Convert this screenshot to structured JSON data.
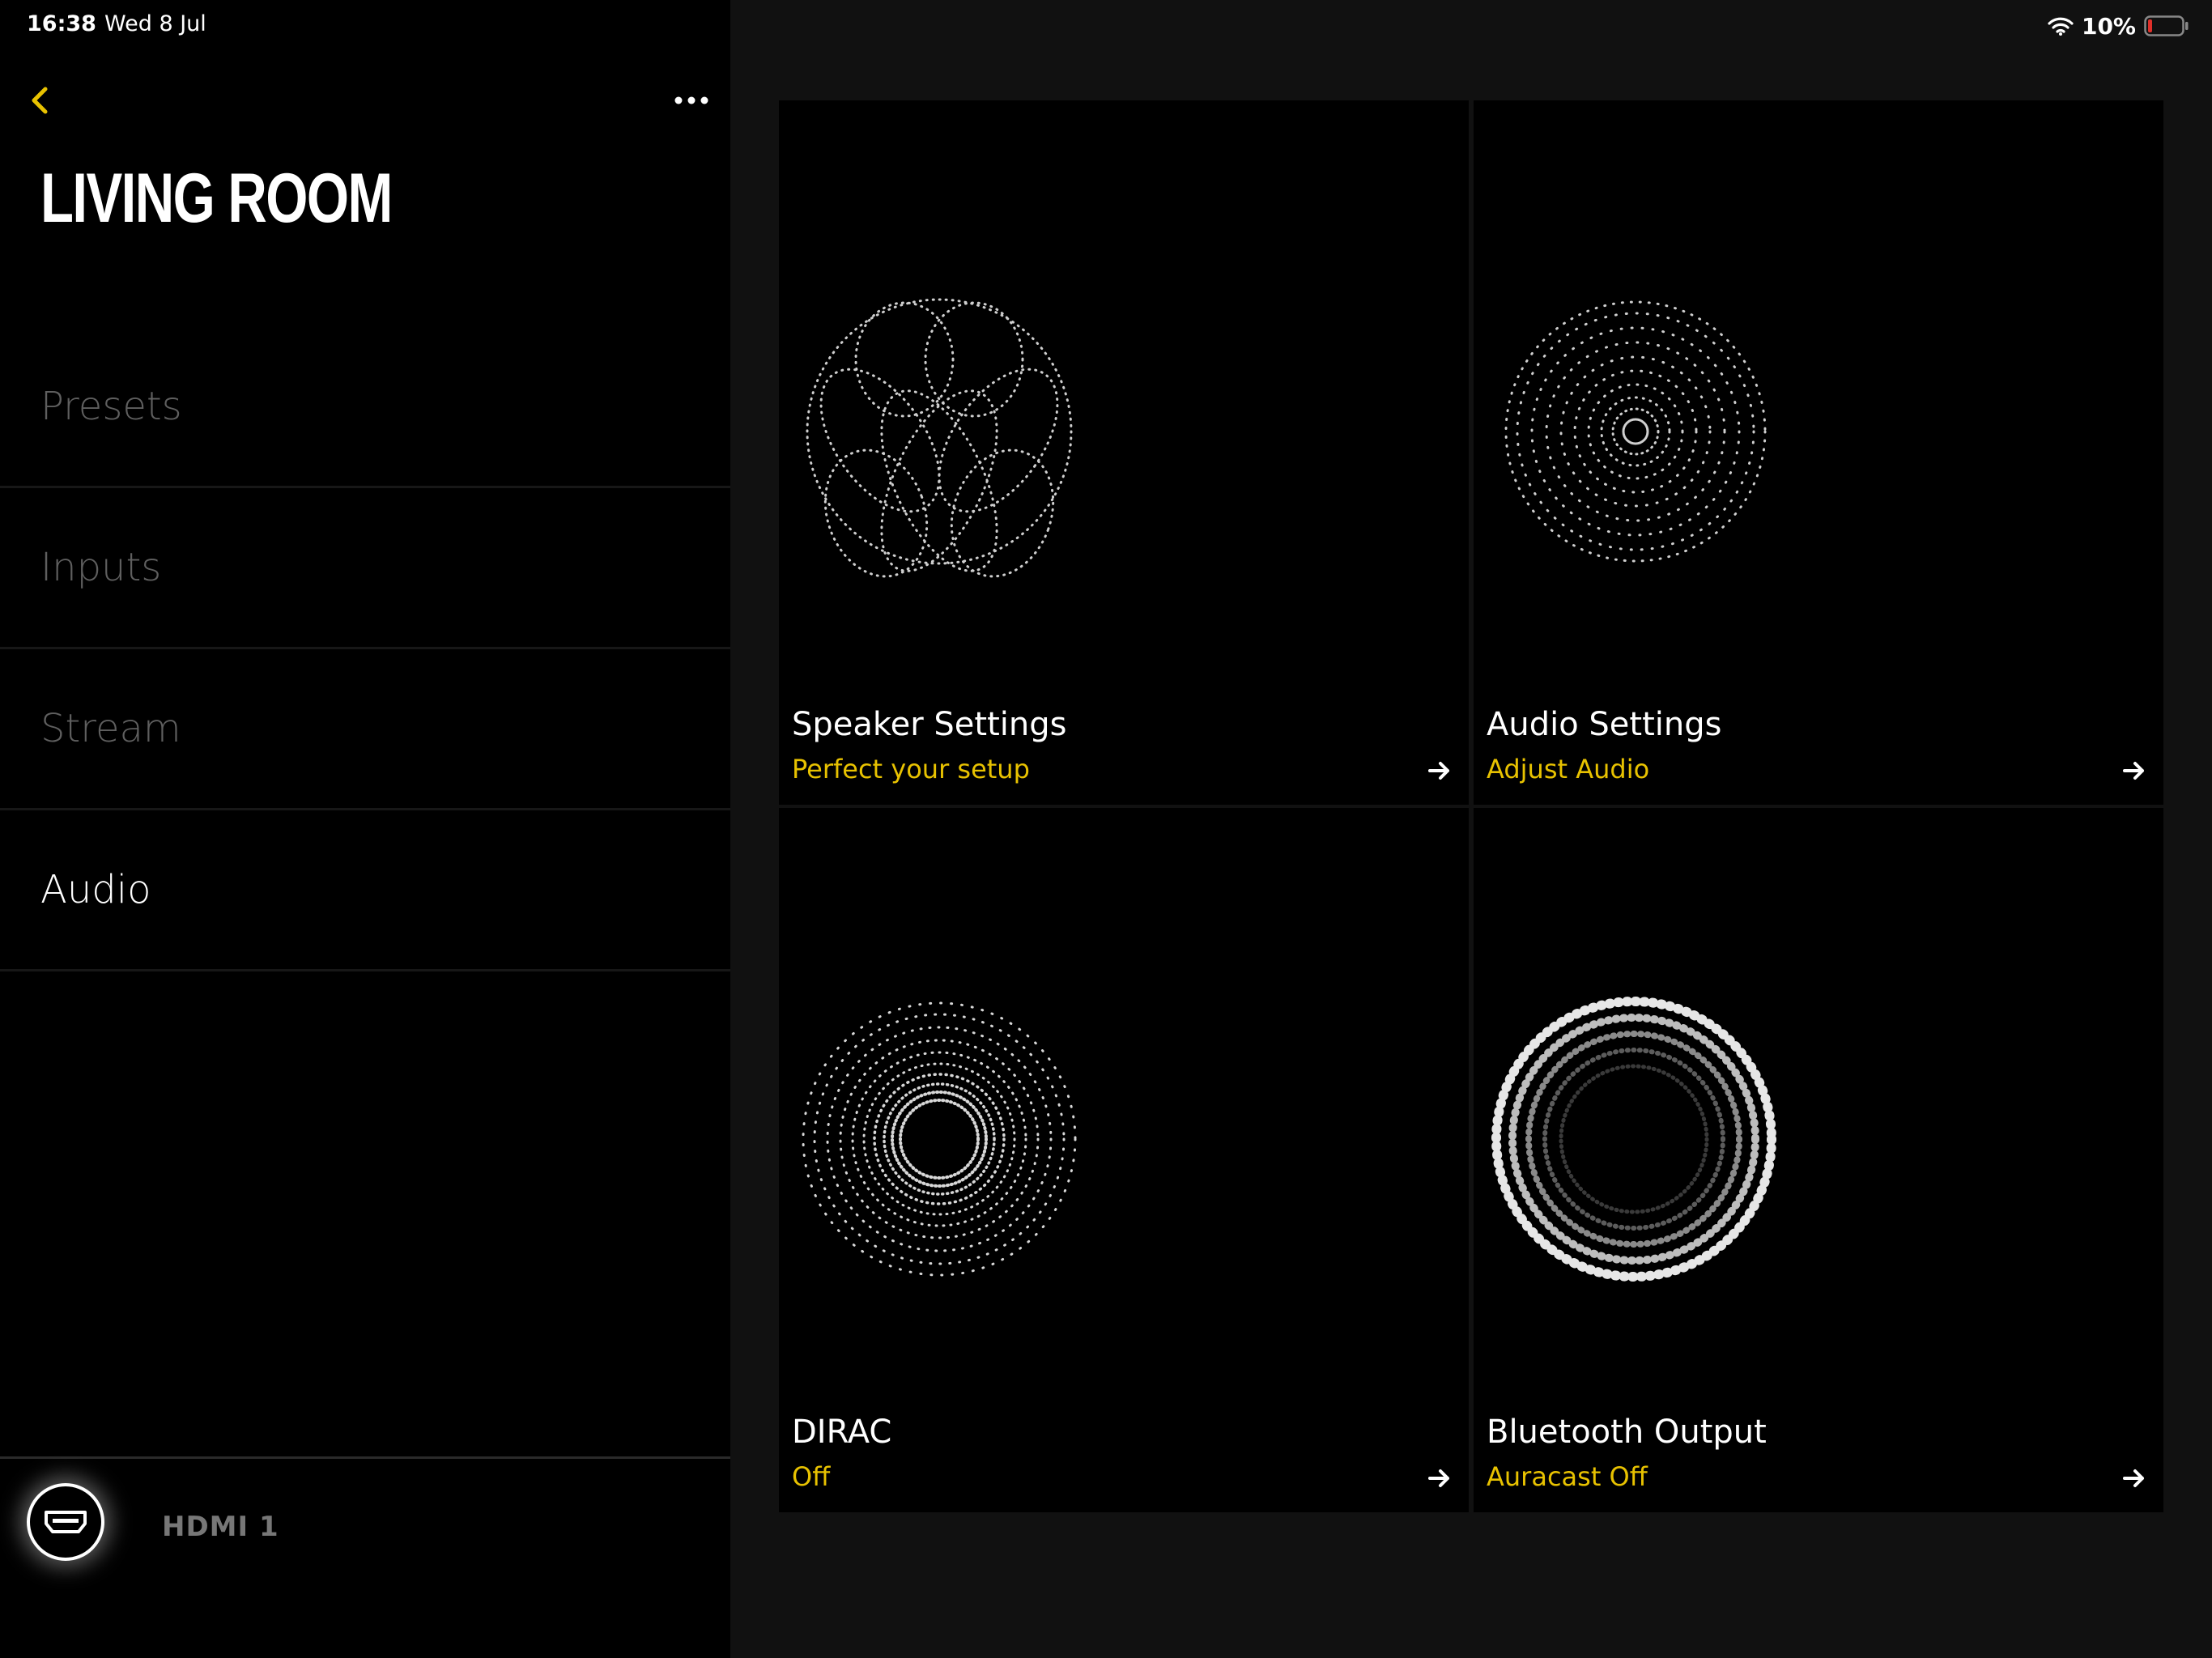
{
  "status_bar": {
    "time": "16:38",
    "date": "Wed 8 Jul",
    "battery_percent": "10%",
    "icons": [
      "wifi-icon",
      "battery-icon"
    ]
  },
  "header": {
    "room_title": "LIVING ROOM",
    "icons": [
      "back-chevron-icon",
      "more-dots-icon"
    ]
  },
  "nav": {
    "items": [
      {
        "label": "Presets",
        "active": false
      },
      {
        "label": "Inputs",
        "active": false
      },
      {
        "label": "Stream",
        "active": false
      },
      {
        "label": "Audio",
        "active": true
      }
    ]
  },
  "footer": {
    "source_label": "HDMI 1",
    "icon": "hdmi-icon"
  },
  "cards": [
    {
      "title": "Speaker Settings",
      "subtitle": "Perfect your setup",
      "icon": "speaker-pattern-icon"
    },
    {
      "title": "Audio Settings",
      "subtitle": "Adjust Audio",
      "icon": "audio-pattern-icon"
    },
    {
      "title": "DIRAC",
      "subtitle": "Off",
      "icon": "dirac-pattern-icon"
    },
    {
      "title": "Bluetooth Output",
      "subtitle": "Auracast Off",
      "icon": "bluetooth-pattern-icon"
    }
  ],
  "colors": {
    "accent": "#e8c200",
    "panel_bg": "#000000",
    "page_bg": "#111111",
    "inactive_text": "#5f5f5f",
    "battery_low": "#e0302a"
  }
}
